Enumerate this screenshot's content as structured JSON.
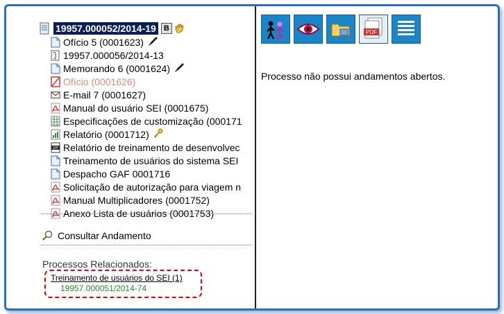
{
  "process": {
    "number": "19957.000052/2014-19",
    "badge": "B"
  },
  "documents": [
    {
      "label": "Ofício 5 (0001623)",
      "icon": "document-icon",
      "signed": true
    },
    {
      "label": "19957.000056/2014-13",
      "icon": "attached-process-icon"
    },
    {
      "label": "Memorando 6 (0001624)",
      "icon": "document-icon",
      "signed": true
    },
    {
      "label": "Ofício (0001626)",
      "icon": "canceled-icon",
      "canceled": true
    },
    {
      "label": "E-mail 7 (0001627)",
      "icon": "email-icon"
    },
    {
      "label": "Manual do usuário SEI (0001675)",
      "icon": "pdf-icon"
    },
    {
      "label": "Especificações de customização (000171",
      "icon": "spreadsheet-icon"
    },
    {
      "label": "Relatório (0001712)",
      "icon": "report-icon",
      "key": true
    },
    {
      "label": "Relatório de treinamento de desenvolvec",
      "icon": "zip-icon"
    },
    {
      "label": "Treinamento de usuários do sistema SEI",
      "icon": "document-icon"
    },
    {
      "label": "Despacho GAF 0001716",
      "icon": "document-icon"
    },
    {
      "label": "Solicitação de autorização para viagem n",
      "icon": "pdf-icon"
    },
    {
      "label": "Manual Multiplicadores (0001752)",
      "icon": "pdf-icon"
    },
    {
      "label": "Anexo Lista de usuários (0001753)",
      "icon": "pdf-icon"
    }
  ],
  "consult": {
    "label": "Consultar Andamento"
  },
  "related": {
    "title": "Processos Relacionados:",
    "process_type": "Treinamento de usuários do SEI (1)",
    "process_number": "19957.000051/2014-74"
  },
  "toolbar": {
    "buttons": [
      "users-icon",
      "eye-icon",
      "folder-icon",
      "pdf-icon",
      "list-icon"
    ],
    "pdf_text": "PDF"
  },
  "message": "Processo não possui andamentos abertos."
}
